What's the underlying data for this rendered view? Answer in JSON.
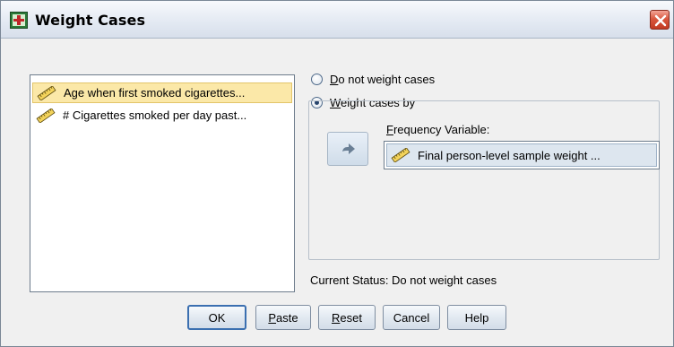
{
  "window": {
    "title": "Weight Cases",
    "icon": "weight-cases-app-icon",
    "close_icon": "close-icon"
  },
  "source_list": {
    "items": [
      {
        "label": "Age when first smoked cigarettes...",
        "icon": "scale-ruler-icon",
        "selected": true
      },
      {
        "label": "# Cigarettes smoked per day past...",
        "icon": "scale-ruler-icon",
        "selected": false
      }
    ]
  },
  "options": {
    "do_not_weight": {
      "label_first": "D",
      "label_rest": "o not weight cases",
      "checked": false
    },
    "weight_by": {
      "label_first": "W",
      "label_rest": "eight cases by",
      "checked": true
    }
  },
  "frequency": {
    "label_first": "F",
    "label_rest": "requency Variable:",
    "value": "Final person-level sample weight ...",
    "icon": "scale-ruler-icon",
    "move_button_icon": "right-arrow-icon"
  },
  "status": {
    "text": "Current Status: Do not weight cases"
  },
  "buttons": {
    "ok": "OK",
    "paste_first": "P",
    "paste_rest": "aste",
    "reset_first": "R",
    "reset_rest": "eset",
    "cancel": "Cancel",
    "help": "Help"
  },
  "colors": {
    "selection": "#fbe8a8",
    "default_button_border": "#3b6fb0",
    "close_button": "#c9432a"
  }
}
